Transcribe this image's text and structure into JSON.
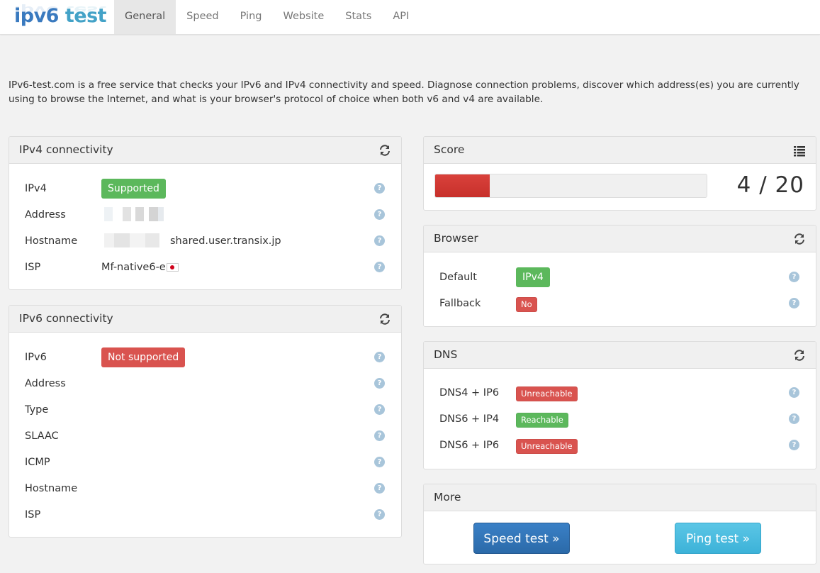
{
  "brand": {
    "part1": "ipv6",
    "part2": " test"
  },
  "nav": {
    "tabs": [
      {
        "label": "General",
        "active": true
      },
      {
        "label": "Speed"
      },
      {
        "label": "Ping"
      },
      {
        "label": "Website"
      },
      {
        "label": "Stats"
      },
      {
        "label": "API"
      }
    ]
  },
  "intro": "IPv6-test.com is a free service that checks your IPv6 and IPv4 connectivity and speed. Diagnose connection problems, discover which address(es) you are currently using to browse the Internet, and what is your browser's protocol of choice when both v6 and v4 are available.",
  "ipv4": {
    "title": "IPv4 connectivity",
    "rows": {
      "ipv4": {
        "label": "IPv4",
        "value": "Supported"
      },
      "address": {
        "label": "Address"
      },
      "hostname": {
        "label": "Hostname",
        "value": "shared.user.transix.jp"
      },
      "isp": {
        "label": "ISP",
        "value": "Mf-native6-e"
      }
    }
  },
  "ipv6": {
    "title": "IPv6 connectivity",
    "rows": {
      "ipv6": {
        "label": "IPv6",
        "value": "Not supported"
      },
      "address": {
        "label": "Address"
      },
      "type": {
        "label": "Type"
      },
      "slaac": {
        "label": "SLAAC"
      },
      "icmp": {
        "label": "ICMP"
      },
      "hostname": {
        "label": "Hostname"
      },
      "isp": {
        "label": "ISP"
      }
    }
  },
  "score": {
    "title": "Score",
    "text": "4 / 20",
    "value": 4,
    "max": 20
  },
  "browser": {
    "title": "Browser",
    "default": {
      "label": "Default",
      "value": "IPv4"
    },
    "fallback": {
      "label": "Fallback",
      "value": "No"
    }
  },
  "dns": {
    "title": "DNS",
    "rows": [
      {
        "label": "DNS4 + IP6",
        "value": "Unreachable"
      },
      {
        "label": "DNS6 + IP4",
        "value": "Reachable"
      },
      {
        "label": "DNS6 + IP6",
        "value": "Unreachable"
      }
    ]
  },
  "more": {
    "title": "More",
    "speed_button": "Speed test »",
    "ping_button": "Ping test »"
  },
  "colors": {
    "success": "#5cb85c",
    "danger": "#d9534f",
    "primary": "#337ab7",
    "info": "#5bc0de"
  },
  "icons": {
    "refresh": "refresh-icon",
    "list": "list-icon",
    "help": "help-icon",
    "flag": "flag-jp-icon"
  }
}
